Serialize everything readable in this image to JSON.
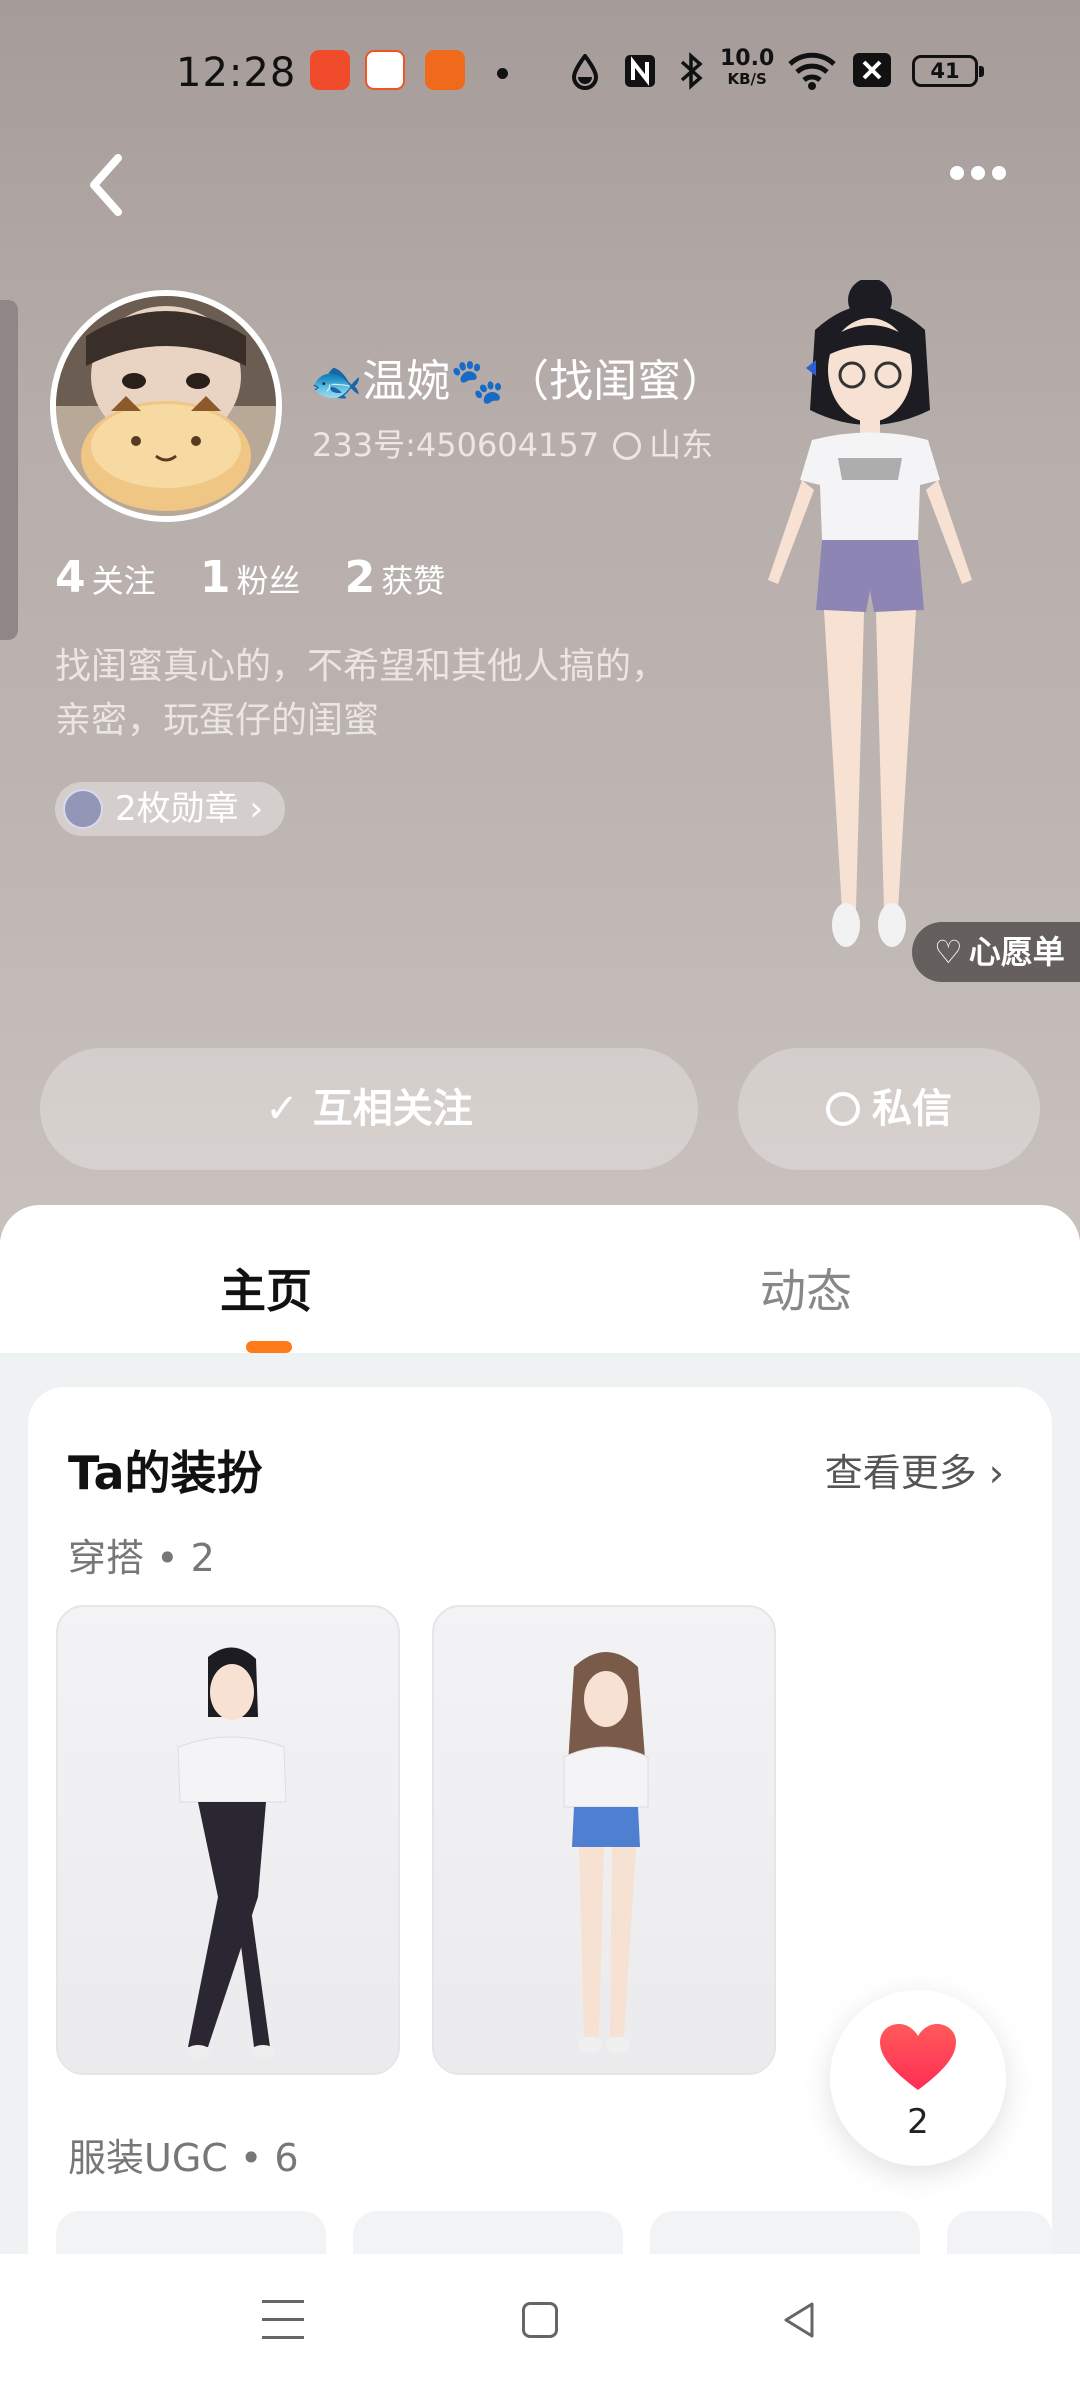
{
  "status": {
    "time": "12:28",
    "net_speed_value": "10.0",
    "net_speed_unit": "KB/S",
    "battery": "41"
  },
  "profile": {
    "name": "温婉",
    "name_suffix": "（找闺蜜）",
    "uid_line": "233号:450604157",
    "location": "山东",
    "stats": [
      {
        "num": "4",
        "label": "关注"
      },
      {
        "num": "1",
        "label": "粉丝"
      },
      {
        "num": "2",
        "label": "获赞"
      }
    ],
    "bio_line1": "找闺蜜真心的，不希望和其他人搞的，",
    "bio_line2": "亲密，玩蛋仔的闺蜜",
    "medals": "2枚勋章",
    "wishlist": "心愿单"
  },
  "actions": {
    "follow": "互相关注",
    "message": "私信"
  },
  "tabs": {
    "home": "主页",
    "feed": "动态"
  },
  "dressup": {
    "title": "Ta的装扮",
    "more": "查看更多",
    "outfit_section": "穿搭 • 2",
    "ugc_section": "服装UGC • 6"
  },
  "like": {
    "count": "2"
  },
  "colors": {
    "accent": "#ff7a1a",
    "like_heart": "#ff3d4f"
  }
}
